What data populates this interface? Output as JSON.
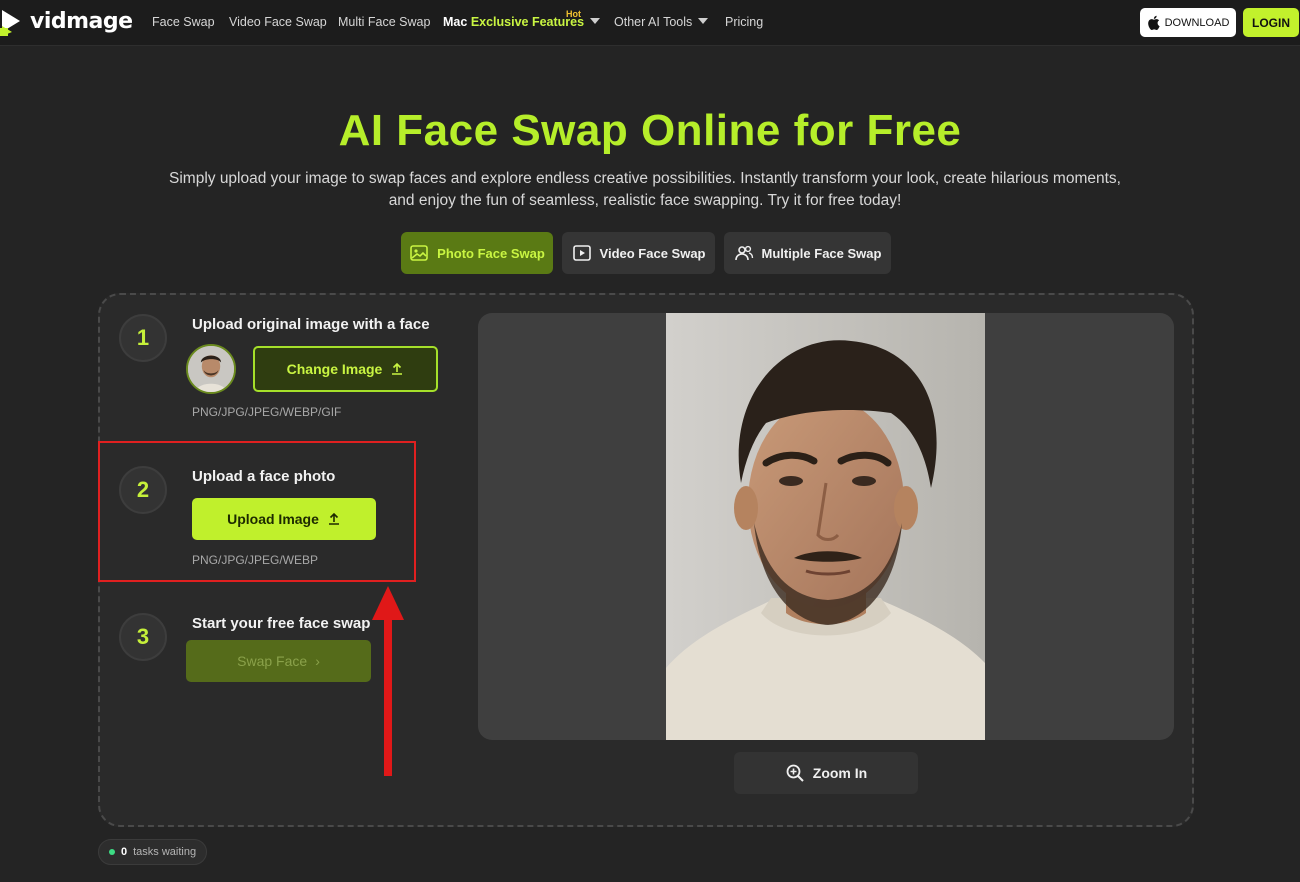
{
  "nav": {
    "logo_text": "vidmage",
    "links": [
      "Face Swap",
      "Video Face Swap",
      "Multi Face Swap"
    ],
    "mac_label_prefix": "Mac",
    "mac_label_accent": "Exclusive Features",
    "hot_badge": "Hot",
    "other_tools": "Other AI Tools",
    "pricing": "Pricing",
    "download_label": "DOWNLOAD",
    "login_label": "LOGIN"
  },
  "hero": {
    "title": "AI Face Swap Online for Free",
    "description_line1": "Simply upload your image to swap faces and explore endless creative possibilities. Instantly transform your look, create hilarious moments,",
    "description_line2": "and enjoy the fun of seamless, realistic face swapping. Try it for free today!"
  },
  "tabs": [
    {
      "label": "Photo Face Swap",
      "active": true,
      "icon": "image-icon"
    },
    {
      "label": "Video Face Swap",
      "active": false,
      "icon": "play-icon"
    },
    {
      "label": "Multiple Face Swap",
      "active": false,
      "icon": "users-icon"
    }
  ],
  "steps": {
    "step1": {
      "number": "1",
      "title": "Upload original image with a face",
      "button": "Change Image",
      "formats": "PNG/JPG/JPEG/WEBP/GIF"
    },
    "step2": {
      "number": "2",
      "title": "Upload a face photo",
      "button": "Upload Image",
      "formats": "PNG/JPG/JPEG/WEBP"
    },
    "step3": {
      "number": "3",
      "title": "Start your free face swap",
      "button": "Swap Face",
      "button_icon": "›"
    }
  },
  "preview": {
    "zoom_label": "Zoom In"
  },
  "tasks": {
    "count": "0",
    "label": "tasks waiting"
  },
  "colors": {
    "accent": "#c0f02c",
    "title": "#b6ee2a",
    "highlight": "#e02020",
    "background": "#242424"
  }
}
